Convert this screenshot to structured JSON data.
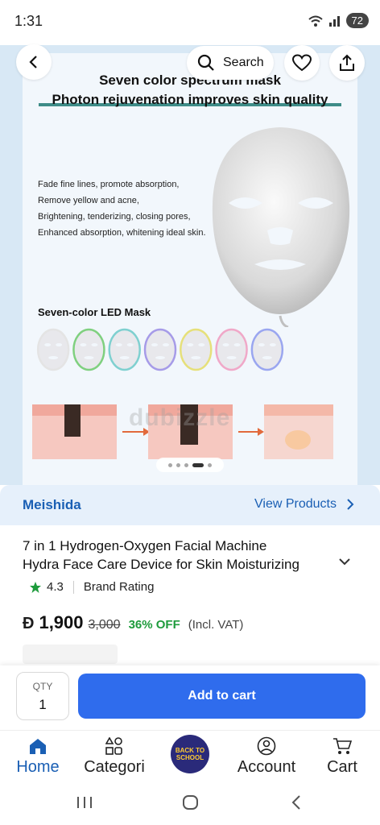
{
  "status_bar": {
    "time": "1:31",
    "battery": "72"
  },
  "top_actions": {
    "search_label": "Search"
  },
  "hero": {
    "heading_line1": "Seven color spectrum mask",
    "heading_line2": "Photon rejuvenation improves skin quality",
    "features": [
      "Fade fine lines, promote absorption,",
      "Remove yellow and acne,",
      "Brightening, tenderizing, closing pores,",
      "Enhanced absorption, whitening ideal skin."
    ],
    "led_label": "Seven-color LED Mask",
    "watermark": "dubizzle",
    "mini_mask_colors": [
      "#e4e4e4",
      "#7fd07f",
      "#7fd0d0",
      "#a69be8",
      "#e6e07a",
      "#f0a8c8",
      "#9aa6f0"
    ],
    "carousel_dots": 5,
    "carousel_active_index": 3
  },
  "seller": {
    "name": "Meishida",
    "view_label": "View Products"
  },
  "product": {
    "title_line1": "7 in 1 Hydrogen-Oxygen Facial Machine",
    "title_line2": "Hydra Face Care Device for Skin Moisturizing",
    "rating": "4.3",
    "rating_label": "Brand Rating",
    "currency_symbol": "Đ",
    "price": "1,900",
    "old_price": "3,000",
    "discount": "36% OFF",
    "vat_note": "(Incl. VAT)"
  },
  "cart": {
    "qty_label": "QTY",
    "qty_value": "1",
    "add_label": "Add to cart"
  },
  "tabs": [
    {
      "label": "Home",
      "icon": "home-icon"
    },
    {
      "label": "Categori",
      "icon": "categories-icon"
    },
    {
      "label": "Account",
      "icon": "account-icon"
    },
    {
      "label": "Cart",
      "icon": "cart-icon"
    }
  ],
  "promo_badge": {
    "line1": "BACK TO",
    "line2": "SCHOOL"
  },
  "colors": {
    "accent": "#2f6ced",
    "link": "#1a5fb4",
    "discount": "#1e9b3c",
    "star": "#1e9b3c"
  }
}
